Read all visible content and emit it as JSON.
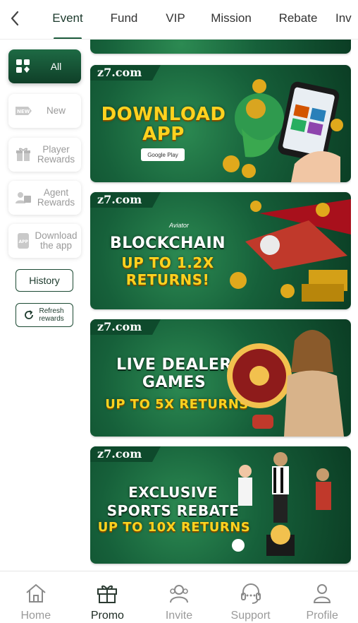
{
  "topbar": {
    "tabs": [
      "Event",
      "Fund",
      "VIP",
      "Mission",
      "Rebate",
      "Inv"
    ],
    "active_tab": "Event"
  },
  "sidebar": {
    "items": [
      {
        "label": "All",
        "icon": "grid-icon"
      },
      {
        "label": "New",
        "icon": "new-tag-icon"
      },
      {
        "label": "Player Rewards",
        "icon": "gift-icon"
      },
      {
        "label": "Agent Rewards",
        "icon": "users-icon"
      },
      {
        "label": "Download the app",
        "icon": "app-icon"
      }
    ],
    "history_label": "History",
    "refresh_label": "Refresh rewards"
  },
  "banners": [
    {
      "brand": "z7.com",
      "line1": "DOWNLOAD",
      "line2": "APP",
      "badge": "Google Play"
    },
    {
      "brand": "z7.com",
      "sub": "Aviator",
      "line1": "BLOCKCHAIN",
      "line2": "UP TO 1.2X",
      "line3": "RETURNS!"
    },
    {
      "brand": "z7.com",
      "line1": "LIVE DEALER",
      "line2": "GAMES",
      "line3": "UP TO 5X RETURNS"
    },
    {
      "brand": "z7.com",
      "line1": "EXCLUSIVE",
      "line2": "SPORTS REBATE",
      "line3": "UP TO 10X RETURNS"
    }
  ],
  "bottom_nav": [
    {
      "label": "Home",
      "icon": "home-icon"
    },
    {
      "label": "Promo",
      "icon": "gift-icon"
    },
    {
      "label": "Invite",
      "icon": "invite-icon"
    },
    {
      "label": "Support",
      "icon": "headset-icon"
    },
    {
      "label": "Profile",
      "icon": "profile-icon"
    }
  ],
  "colors": {
    "accent": "#1c5a3b",
    "banner_green": "#16603a",
    "highlight": "#ffd21f"
  }
}
